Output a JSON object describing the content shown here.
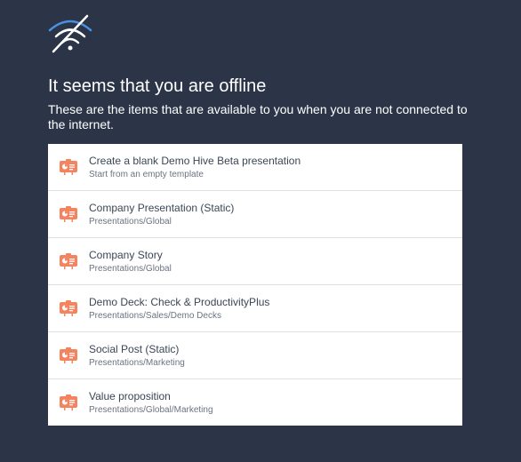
{
  "header": {
    "icon": "wifi-off-icon",
    "title": "It seems that you are offline",
    "subtitle": "These are the items that are available to you when you are not connected to the internet."
  },
  "colors": {
    "background": "#2b3547",
    "icon_accent": "#4a90e2",
    "item_icon": "#f4845f"
  },
  "items": [
    {
      "title": "Create a blank Demo Hive Beta presentation",
      "path": "Start from an empty template",
      "icon": "presentation-icon"
    },
    {
      "title": "Company Presentation (Static)",
      "path": "Presentations/Global",
      "icon": "presentation-icon"
    },
    {
      "title": "Company Story",
      "path": "Presentations/Global",
      "icon": "presentation-icon"
    },
    {
      "title": "Demo Deck: Check & ProductivityPlus",
      "path": "Presentations/Sales/Demo Decks",
      "icon": "presentation-icon"
    },
    {
      "title": "Social Post (Static)",
      "path": "Presentations/Marketing",
      "icon": "presentation-icon"
    },
    {
      "title": "Value proposition",
      "path": "Presentations/Global/Marketing",
      "icon": "presentation-icon"
    }
  ]
}
